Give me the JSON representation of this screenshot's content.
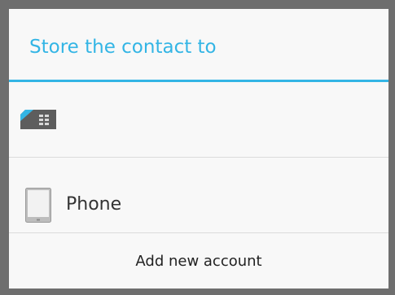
{
  "dialog": {
    "title": "Store the contact to",
    "accent_color": "#33b5e5",
    "options": [
      {
        "icon": "sim-card-icon",
        "label": ""
      },
      {
        "icon": "phone-icon",
        "label": "Phone"
      }
    ],
    "add_account_label": "Add new account"
  }
}
